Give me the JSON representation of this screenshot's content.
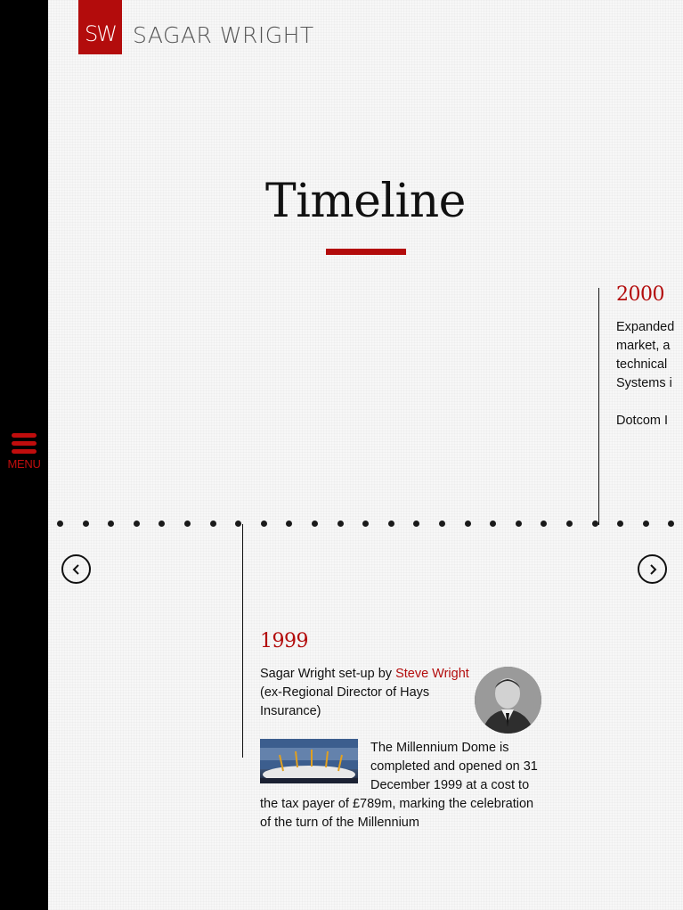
{
  "brand": {
    "mark": "SW",
    "name": "SAGAR WRIGHT",
    "accent_color": "#b30c0c"
  },
  "sidebar": {
    "menu_label": "MENU",
    "menu_icon": "hamburger-icon"
  },
  "page": {
    "title": "Timeline"
  },
  "timeline": {
    "prev_icon": "chevron-left-icon",
    "next_icon": "chevron-right-icon",
    "entries": [
      {
        "year": "1999",
        "text_before_link": "Sagar Wright set-up by ",
        "link": "Steve Wright",
        "text_after_link": "(ex-Regional Director of Hays Insurance)",
        "secondary_text": "The Millennium Dome is completed and opened on 31 December 1999 at a cost to the tax payer of £789m, marking the celebration of the turn of the Millennium"
      },
      {
        "year": "2000",
        "lines": [
          "Expanded",
          "market, a",
          "technical",
          "Systems i"
        ],
        "secondary_text": "Dotcom I"
      }
    ]
  }
}
